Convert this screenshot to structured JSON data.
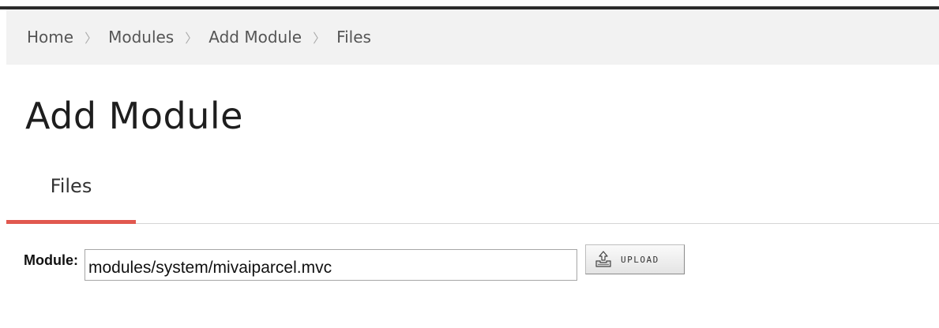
{
  "breadcrumb": {
    "items": [
      {
        "label": "Home"
      },
      {
        "label": "Modules"
      },
      {
        "label": "Add Module"
      },
      {
        "label": "Files"
      }
    ],
    "separator": "〉"
  },
  "page": {
    "title": "Add Module"
  },
  "tabs": [
    {
      "label": "Files",
      "active": true
    }
  ],
  "form": {
    "module_label": "Module:",
    "module_value": "modules/system/mivaiparcel.mvc",
    "upload_button_label": "UPLOAD",
    "upload_icon": "upload-icon"
  },
  "colors": {
    "active_tab_underline": "#e1584f",
    "breadcrumb_background": "#f2f2f2",
    "top_rule": "#2b2b2b"
  }
}
